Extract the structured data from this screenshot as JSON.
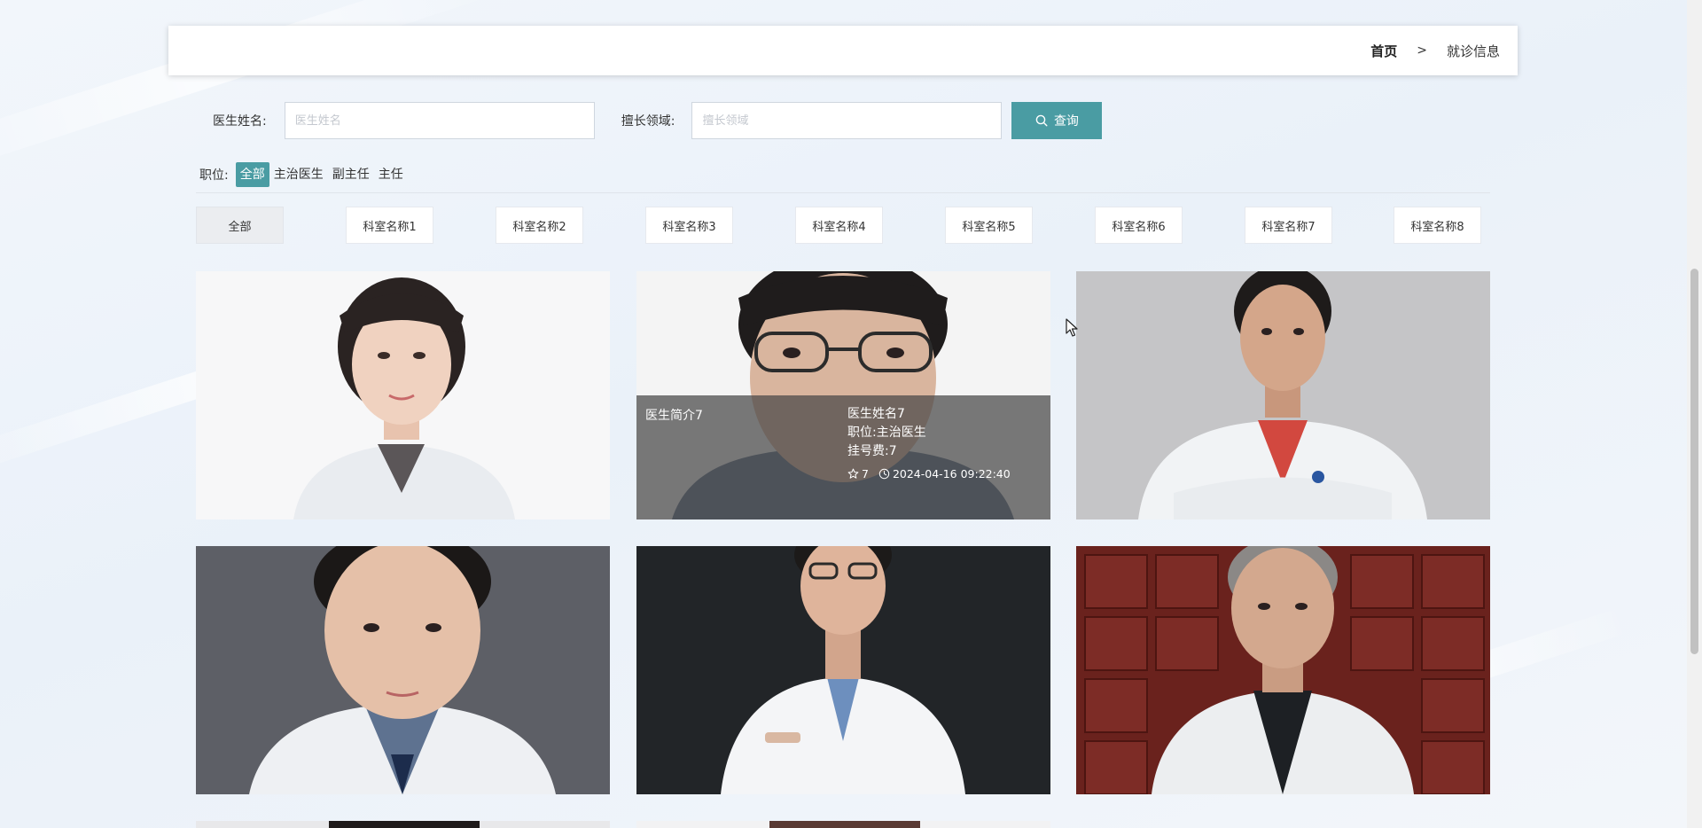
{
  "breadcrumb": {
    "home": "首页",
    "separator": ">",
    "current": "就诊信息"
  },
  "search": {
    "name_label": "医生姓名:",
    "name_placeholder": "医生姓名",
    "name_value": "",
    "field_label": "擅长领域:",
    "field_placeholder": "擅长领域",
    "field_value": "",
    "button_label": "查询",
    "button_icon": "search-icon"
  },
  "positions": {
    "label": "职位:",
    "items": [
      "全部",
      "主治医生",
      "副主任",
      "主任"
    ],
    "active_index": 0
  },
  "departments": {
    "items": [
      "全部",
      "科室名称1",
      "科室名称2",
      "科室名称3",
      "科室名称4",
      "科室名称5",
      "科室名称6",
      "科室名称7",
      "科室名称8"
    ],
    "active_index": 0
  },
  "hovered_card": {
    "intro": "医生简介7",
    "name": "医生姓名7",
    "position": "职位:主治医生",
    "fee": "挂号费:7",
    "likes": "7",
    "time": "2024-04-16 09:22:40"
  },
  "colors": {
    "accent": "#4a9ca3",
    "header_bg": "#ffffff",
    "page_bg": "#edf3fa"
  }
}
